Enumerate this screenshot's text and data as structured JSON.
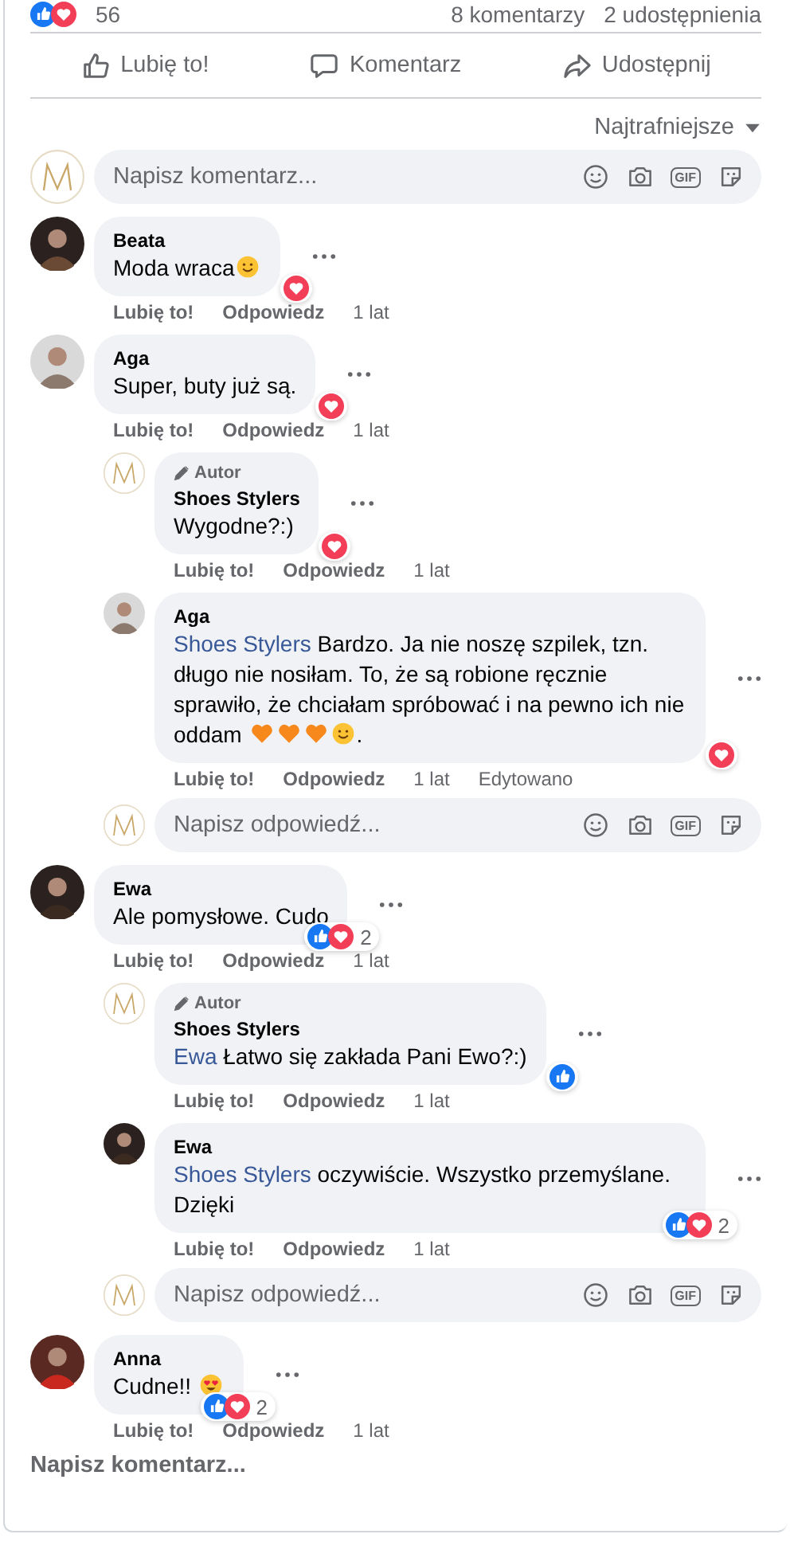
{
  "summary": {
    "reaction_count": "56",
    "comments": "8 komentarzy",
    "shares": "2 udostępnienia"
  },
  "actions": [
    {
      "kind": "like",
      "label": "Lubię to!"
    },
    {
      "kind": "comment",
      "label": "Komentarz"
    },
    {
      "kind": "share",
      "label": "Udostępnij"
    }
  ],
  "sort": {
    "label": "Najtrafniejsze"
  },
  "composer": {
    "placeholder": "Napisz komentarz...",
    "gif_label": "GIF"
  },
  "comments": [
    {
      "author": "Beata",
      "avatar": {
        "kind": "photo"
      },
      "parts": [
        {
          "kind": "text",
          "text": "Moda wraca"
        },
        {
          "kind": "smile"
        }
      ],
      "reactions": [
        {
          "kind": "love"
        }
      ],
      "meta": [
        {
          "kind": "link",
          "text": "Lubię to!"
        },
        {
          "kind": "link",
          "text": "Odpowiedz"
        },
        {
          "kind": "time",
          "text": "1 lat"
        }
      ]
    },
    {
      "author": "Aga",
      "avatar": {
        "kind": "photo"
      },
      "parts": [
        {
          "kind": "text",
          "text": "Super, buty już są."
        }
      ],
      "reactions": [
        {
          "kind": "love"
        }
      ],
      "meta": [
        {
          "kind": "link",
          "text": "Lubię to!"
        },
        {
          "kind": "link",
          "text": "Odpowiedz"
        },
        {
          "kind": "time",
          "text": "1 lat"
        }
      ],
      "replies": [
        {
          "author": "Shoes Stylers",
          "avatar": {
            "kind": "brand"
          },
          "badge": "Autor",
          "parts": [
            {
              "kind": "text",
              "text": "Wygodne?:)"
            }
          ],
          "reactions": [
            {
              "kind": "love"
            }
          ],
          "meta": [
            {
              "kind": "link",
              "text": "Lubię to!"
            },
            {
              "kind": "link",
              "text": "Odpowiedz"
            },
            {
              "kind": "time",
              "text": "1 lat"
            }
          ]
        },
        {
          "author": "Aga",
          "avatar": {
            "kind": "photo"
          },
          "parts": [
            {
              "kind": "mention",
              "text": "Shoes Stylers"
            },
            {
              "kind": "text",
              "text": " Bardzo. Ja nie noszę szpilek, tzn. długo nie nosiłam. To, że są robione ręcznie sprawiło, że chciałam spróbować i na pewno ich nie oddam "
            },
            {
              "kind": "heart"
            },
            {
              "kind": "heart"
            },
            {
              "kind": "heart"
            },
            {
              "kind": "smile"
            },
            {
              "kind": "text",
              "text": "."
            }
          ],
          "reactions": [
            {
              "kind": "love"
            }
          ],
          "meta": [
            {
              "kind": "link",
              "text": "Lubię to!"
            },
            {
              "kind": "link",
              "text": "Odpowiedz"
            },
            {
              "kind": "time",
              "text": "1 lat"
            },
            {
              "kind": "time",
              "text": "Edytowano"
            }
          ]
        }
      ],
      "reply_box": {
        "placeholder": "Napisz odpowiedź...",
        "gif_label": "GIF"
      }
    },
    {
      "author": "Ewa",
      "avatar": {
        "kind": "photo"
      },
      "parts": [
        {
          "kind": "text",
          "text": "Ale pomysłowe. Cudo"
        }
      ],
      "reactions": [
        {
          "kind": "like"
        },
        {
          "kind": "love"
        }
      ],
      "reaction_count": "2",
      "meta": [
        {
          "kind": "link",
          "text": "Lubię to!"
        },
        {
          "kind": "link",
          "text": "Odpowiedz"
        },
        {
          "kind": "time",
          "text": "1 lat"
        }
      ],
      "replies": [
        {
          "author": "Shoes Stylers",
          "avatar": {
            "kind": "brand"
          },
          "badge": "Autor",
          "parts": [
            {
              "kind": "mention",
              "text": "Ewa"
            },
            {
              "kind": "text",
              "text": " Łatwo się zakłada Pani Ewo?:)"
            }
          ],
          "reactions": [
            {
              "kind": "like"
            }
          ],
          "meta": [
            {
              "kind": "link",
              "text": "Lubię to!"
            },
            {
              "kind": "link",
              "text": "Odpowiedz"
            },
            {
              "kind": "time",
              "text": "1 lat"
            }
          ]
        },
        {
          "author": "Ewa",
          "avatar": {
            "kind": "photo"
          },
          "parts": [
            {
              "kind": "mention",
              "text": "Shoes Stylers"
            },
            {
              "kind": "text",
              "text": " oczywiście. Wszystko przemyślane. Dzięki"
            }
          ],
          "reactions": [
            {
              "kind": "like"
            },
            {
              "kind": "love"
            }
          ],
          "reaction_count": "2",
          "meta": [
            {
              "kind": "link",
              "text": "Lubię to!"
            },
            {
              "kind": "link",
              "text": "Odpowiedz"
            },
            {
              "kind": "time",
              "text": "1 lat"
            }
          ]
        }
      ],
      "reply_box": {
        "placeholder": "Napisz odpowiedź...",
        "gif_label": "GIF"
      }
    },
    {
      "author": "Anna",
      "avatar": {
        "kind": "photo"
      },
      "parts": [
        {
          "kind": "text",
          "text": "Cudne!! "
        },
        {
          "kind": "hearteyes"
        }
      ],
      "reactions": [
        {
          "kind": "like"
        },
        {
          "kind": "love"
        }
      ],
      "reaction_count": "2",
      "meta": [
        {
          "kind": "link",
          "text": "Lubię to!"
        },
        {
          "kind": "link",
          "text": "Odpowiedz"
        },
        {
          "kind": "time",
          "text": "1 lat"
        }
      ]
    }
  ],
  "footer": {
    "label": "Napisz komentarz..."
  }
}
